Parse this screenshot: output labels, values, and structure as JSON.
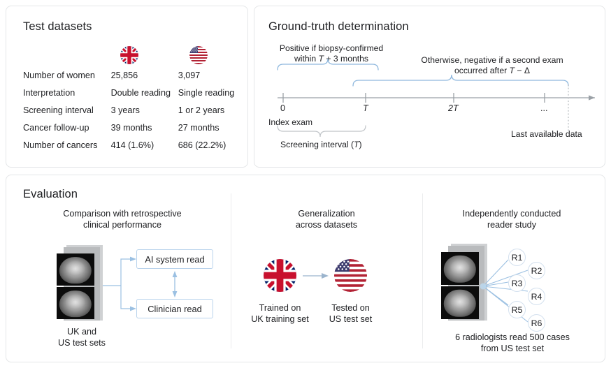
{
  "figure": {
    "accent_blue": "#8fb8de",
    "axis_gray": "#9aa0a6",
    "panel_border": "#e4e6e8"
  },
  "datasets_panel": {
    "title": "Test datasets",
    "flags": [
      {
        "name": "uk-flag-icon",
        "label": "United Kingdom"
      },
      {
        "name": "us-flag-icon",
        "label": "United States"
      }
    ],
    "rows": [
      {
        "label": "Number of women",
        "uk": "25,856",
        "us": "3,097"
      },
      {
        "label": "Interpretation",
        "uk": "Double reading",
        "us": "Single reading"
      },
      {
        "label": "Screening interval",
        "uk": "3 years",
        "us": "1 or 2 years"
      },
      {
        "label": "Cancer follow-up",
        "uk": "39 months",
        "us": "27 months"
      },
      {
        "label": "Number of cancers",
        "uk": "414 (1.6%)",
        "us": "686 (22.2%)"
      }
    ]
  },
  "ground_truth_panel": {
    "title": "Ground-truth determination",
    "caption_positive_line1": "Positive if biopsy-confirmed",
    "caption_positive_line2_pre": "within ",
    "caption_positive_line2_var": "T",
    "caption_positive_line2_post": " + 3 months",
    "caption_negative_line1": "Otherwise, negative if a second exam",
    "caption_negative_line2_pre": "occurred after ",
    "caption_negative_line2_var": "T",
    "caption_negative_line2_post": " − Δ",
    "ticks": [
      {
        "label": "0",
        "italic": false
      },
      {
        "label": "T",
        "italic": true
      },
      {
        "label": "2T",
        "italic": true
      },
      {
        "label": "...",
        "italic": false
      }
    ],
    "index_exam_label": "Index exam",
    "last_data_label": "Last available data",
    "screening_interval_pre": "Screening interval (",
    "screening_interval_var": "T",
    "screening_interval_post": ")"
  },
  "evaluation_panel": {
    "title": "Evaluation",
    "sections": [
      {
        "head_line1": "Comparison with retrospective",
        "head_line2": "clinical performance",
        "box_ai": "AI system read",
        "box_clinician": "Clinician read",
        "foot_line1": "UK and",
        "foot_line2": "US test sets"
      },
      {
        "head_line1": "Generalization",
        "head_line2": "across datasets",
        "left_foot_line1": "Trained on",
        "left_foot_line2": "UK training set",
        "right_foot_line1": "Tested on",
        "right_foot_line2": "US test set"
      },
      {
        "head_line1": "Independently conducted",
        "head_line2": "reader study",
        "readers": [
          "R1",
          "R2",
          "R3",
          "R4",
          "R5",
          "R6"
        ],
        "foot_line1": "6 radiologists read 500 cases",
        "foot_line2": "from US test set"
      }
    ]
  }
}
